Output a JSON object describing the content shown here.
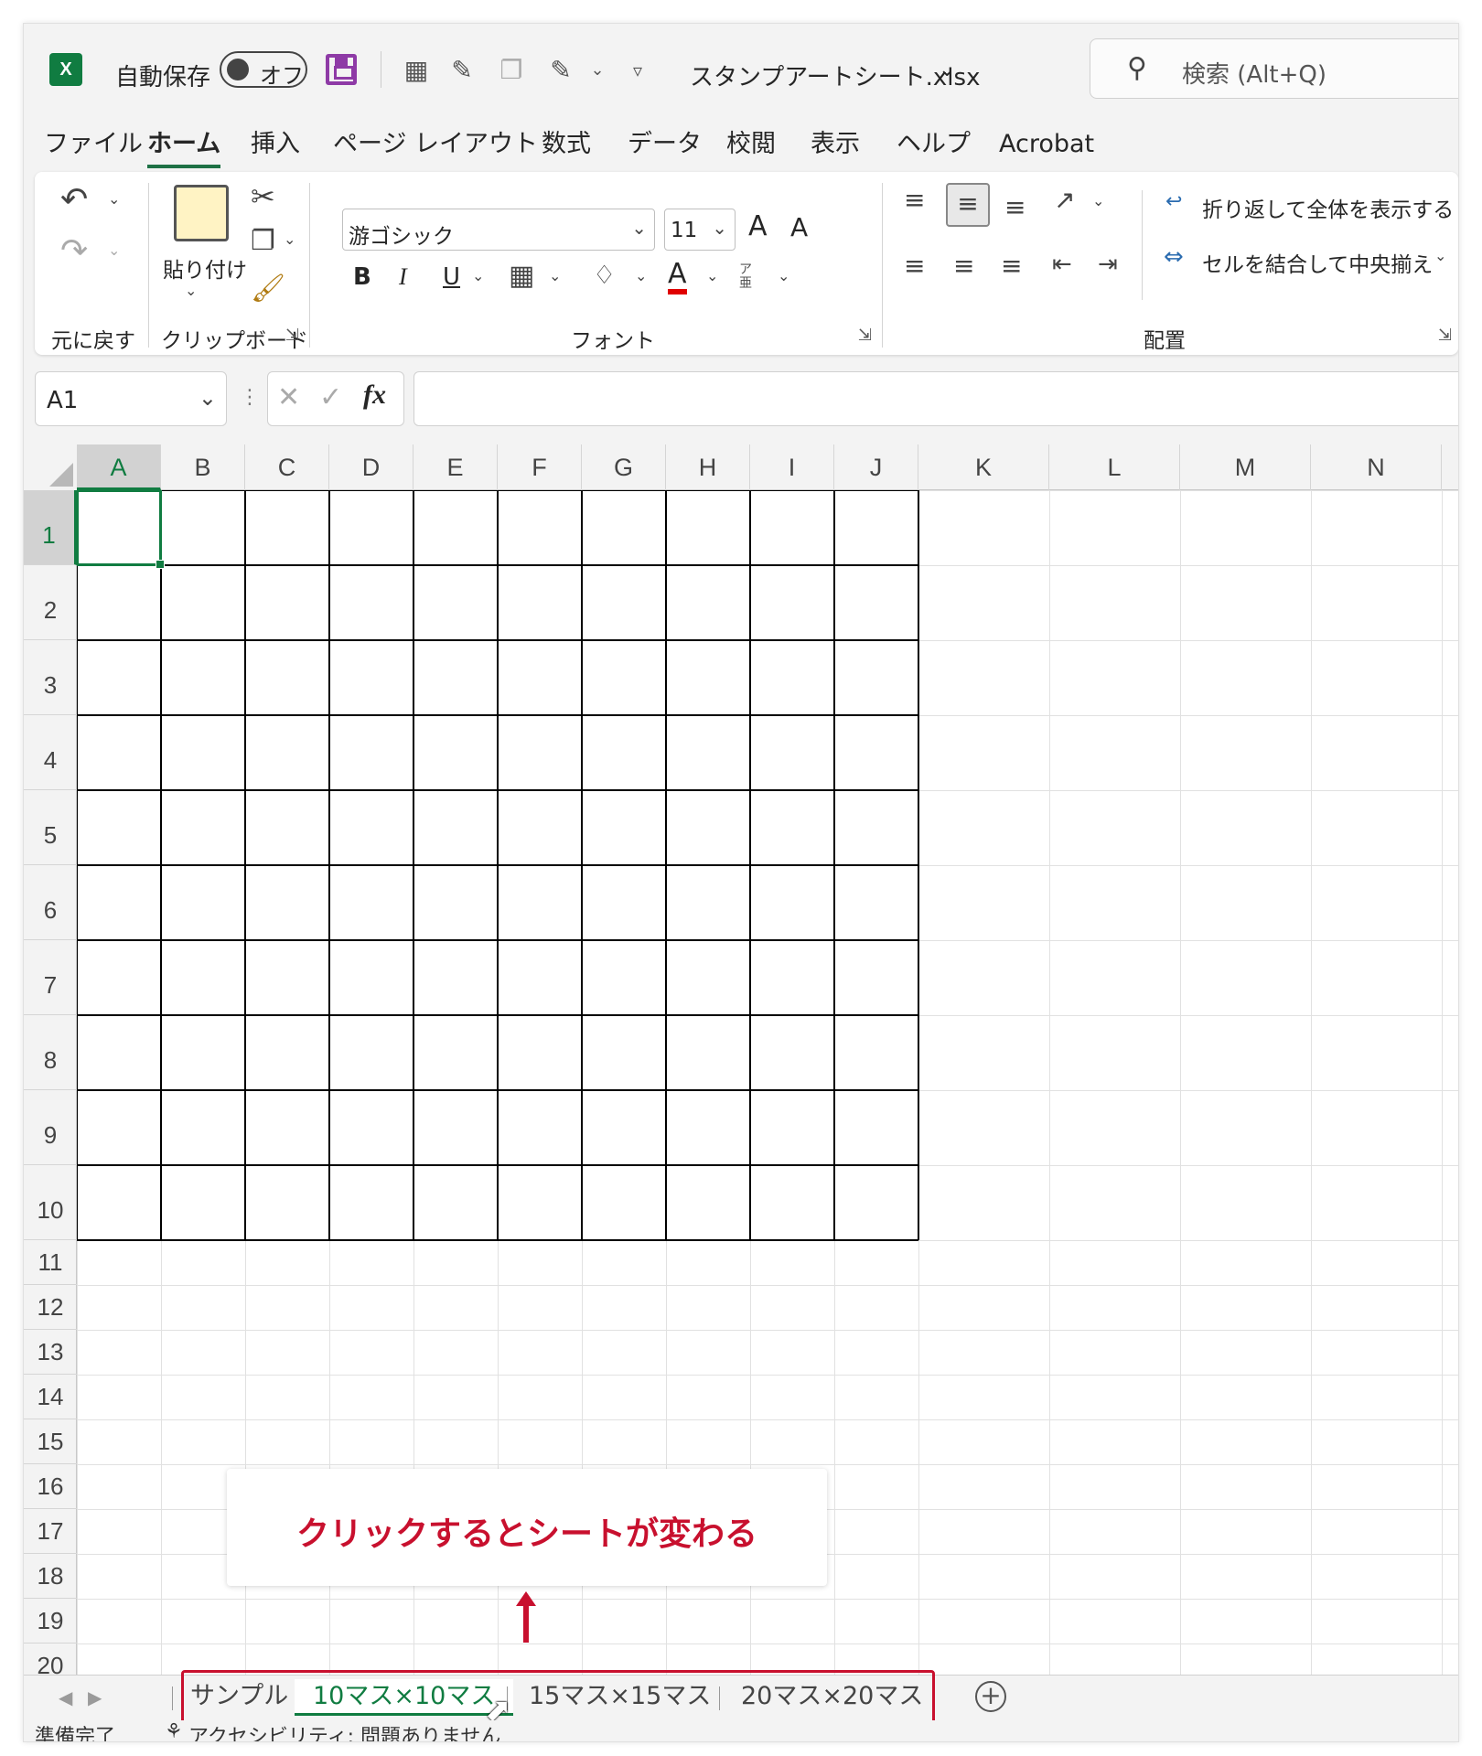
{
  "titlebar": {
    "app_icon": "X",
    "autosave_label": "自動保存",
    "autosave_state": "オフ",
    "filename": "スタンプアートシート.xlsx",
    "search_placeholder": "検索 (Alt+Q)"
  },
  "tabs": [
    "ファイル",
    "ホーム",
    "挿入",
    "ページ レイアウト",
    "数式",
    "データ",
    "校閲",
    "表示",
    "ヘルプ",
    "Acrobat"
  ],
  "active_tab": "ホーム",
  "ribbon": {
    "undo_group": "元に戻す",
    "clipboard_group": "クリップボード",
    "paste_label": "貼り付け",
    "font_group": "フォント",
    "font_name": "游ゴシック",
    "font_size": "11",
    "bold": "B",
    "italic": "I",
    "underline": "U",
    "font_color_letter": "A",
    "grow_font": "A",
    "shrink_font": "A",
    "phonetic": "ア亜",
    "align_group": "配置",
    "wrap_text": "折り返して全体を表示する",
    "merge_center": "セルを結合して中央揃え"
  },
  "formula_bar": {
    "name_box": "A1",
    "fx": "fx",
    "value": ""
  },
  "grid": {
    "columns": [
      "A",
      "B",
      "C",
      "D",
      "E",
      "F",
      "G",
      "H",
      "I",
      "J",
      "K",
      "L",
      "M",
      "N"
    ],
    "rows": [
      "1",
      "2",
      "3",
      "4",
      "5",
      "6",
      "7",
      "8",
      "9",
      "10",
      "11",
      "12",
      "13",
      "14",
      "15",
      "16",
      "17",
      "18",
      "19",
      "20"
    ],
    "selected_cell": "A1"
  },
  "callout": "クリックするとシートが変わる",
  "sheets": [
    "サンプル",
    "10マス×10マス",
    "15マス×15マス",
    "20マス×20マス"
  ],
  "active_sheet": "10マス×10マス",
  "status": {
    "ready": "準備完了",
    "accessibility": "アクセシビリティ: 問題ありません"
  },
  "colors": {
    "excel_green": "#107c41",
    "highlight_red": "#c8102e",
    "save_purple": "#8e3aa6"
  }
}
